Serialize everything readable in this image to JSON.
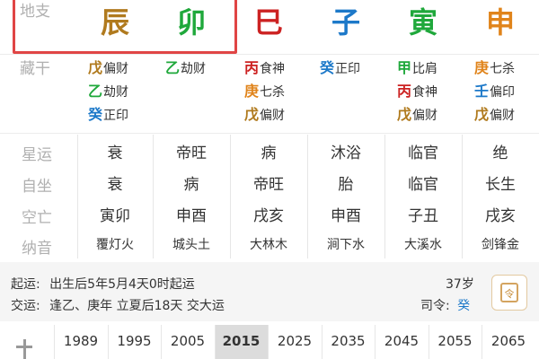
{
  "colors": {
    "earth": "#b07a1e",
    "wood": "#1fa83b",
    "fire": "#cc2222",
    "water": "#1d79c9",
    "metal": "#e0841b",
    "highlight": "#e04545",
    "label": "#b0b0b0"
  },
  "row_labels": {
    "dizhi": "地支",
    "canggan": "藏干",
    "xingyun": "星运",
    "zizuo": "自坐",
    "kongwang": "空亡",
    "nayin": "纳音"
  },
  "pillars": [
    {
      "branch": "辰",
      "branch_color": "#b07a1e",
      "hidden": [
        {
          "char": "戊",
          "color": "#b07a1e",
          "god": "偏财"
        },
        {
          "char": "乙",
          "color": "#1fa83b",
          "god": "劫财"
        },
        {
          "char": "癸",
          "color": "#1d79c9",
          "god": "正印"
        }
      ],
      "xingyun": "衰",
      "zizuo": "衰",
      "kongwang": "寅卯",
      "nayin": "覆灯火"
    },
    {
      "branch": "卯",
      "branch_color": "#1fa83b",
      "hidden": [
        {
          "char": "乙",
          "color": "#1fa83b",
          "god": "劫财"
        }
      ],
      "xingyun": "帝旺",
      "zizuo": "病",
      "kongwang": "申酉",
      "nayin": "城头土"
    },
    {
      "branch": "巳",
      "branch_color": "#cc2222",
      "hidden": [
        {
          "char": "丙",
          "color": "#cc2222",
          "god": "食神"
        },
        {
          "char": "庚",
          "color": "#e0841b",
          "god": "七杀"
        },
        {
          "char": "戊",
          "color": "#b07a1e",
          "god": "偏财"
        }
      ],
      "xingyun": "病",
      "zizuo": "帝旺",
      "kongwang": "戌亥",
      "nayin": "大林木"
    },
    {
      "branch": "子",
      "branch_color": "#1d79c9",
      "hidden": [
        {
          "char": "癸",
          "color": "#1d79c9",
          "god": "正印"
        }
      ],
      "xingyun": "沐浴",
      "zizuo": "胎",
      "kongwang": "申酉",
      "nayin": "涧下水"
    },
    {
      "branch": "寅",
      "branch_color": "#1fa83b",
      "hidden": [
        {
          "char": "甲",
          "color": "#1fa83b",
          "god": "比肩"
        },
        {
          "char": "丙",
          "color": "#cc2222",
          "god": "食神"
        },
        {
          "char": "戊",
          "color": "#b07a1e",
          "god": "偏财"
        }
      ],
      "xingyun": "临官",
      "zizuo": "临官",
      "kongwang": "子丑",
      "nayin": "大溪水"
    },
    {
      "branch": "申",
      "branch_color": "#e0841b",
      "hidden": [
        {
          "char": "庚",
          "color": "#e0841b",
          "god": "七杀"
        },
        {
          "char": "壬",
          "color": "#1d79c9",
          "god": "偏印"
        },
        {
          "char": "戊",
          "color": "#b07a1e",
          "god": "偏财"
        }
      ],
      "xingyun": "绝",
      "zizuo": "长生",
      "kongwang": "戌亥",
      "nayin": "剑锋金"
    }
  ],
  "yun_info": {
    "qiyun_label": "起运:",
    "qiyun_text": "出生后5年5月4天0时起运",
    "jiaoyun_label": "交运:",
    "jiaoyun_text": "逢乙、庚年 立夏后18天 交大运",
    "age": "37岁",
    "siling_label": "司令:",
    "siling_value": "癸",
    "calendar_icon_text": "令"
  },
  "timeline": {
    "years": [
      "1989",
      "1995",
      "2005",
      "2015",
      "2025",
      "2035",
      "2045",
      "2055",
      "2065"
    ],
    "selected": "2015"
  }
}
